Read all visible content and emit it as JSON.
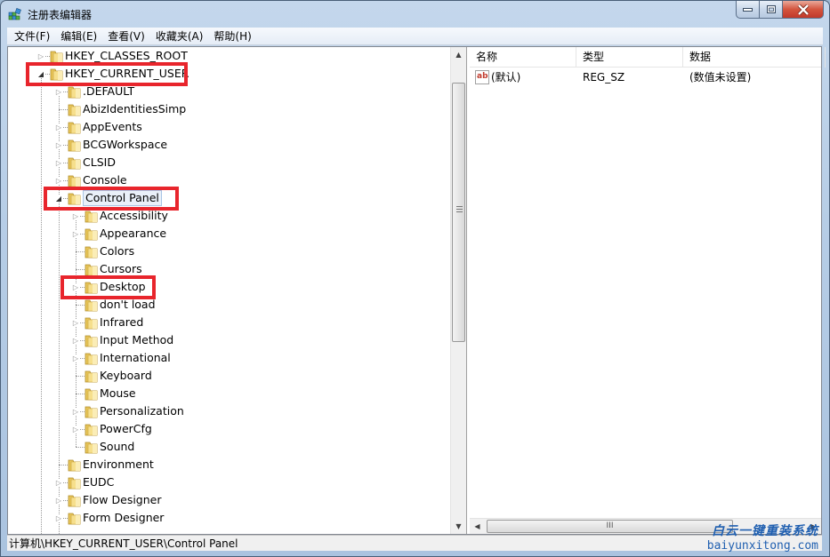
{
  "window": {
    "title": "注册表编辑器",
    "accent_close": "#c0392b"
  },
  "menu": [
    {
      "label": "文件(F)"
    },
    {
      "label": "编辑(E)"
    },
    {
      "label": "查看(V)"
    },
    {
      "label": "收藏夹(A)"
    },
    {
      "label": "帮助(H)"
    }
  ],
  "tree": {
    "items": [
      {
        "label": "HKEY_CLASSES_ROOT",
        "level": 0,
        "expander": "collapsed"
      },
      {
        "label": "HKEY_CURRENT_USER",
        "level": 0,
        "expander": "expanded",
        "highlighted": true
      },
      {
        "label": ".DEFAULT",
        "level": 1,
        "expander": "collapsed"
      },
      {
        "label": "AbizIdentitiesSimp",
        "level": 1,
        "expander": "none"
      },
      {
        "label": "AppEvents",
        "level": 1,
        "expander": "collapsed"
      },
      {
        "label": "BCGWorkspace",
        "level": 1,
        "expander": "collapsed"
      },
      {
        "label": "CLSID",
        "level": 1,
        "expander": "collapsed"
      },
      {
        "label": "Console",
        "level": 1,
        "expander": "collapsed"
      },
      {
        "label": "Control Panel",
        "level": 1,
        "expander": "expanded",
        "selected": true,
        "highlighted": true
      },
      {
        "label": "Accessibility",
        "level": 2,
        "expander": "collapsed"
      },
      {
        "label": "Appearance",
        "level": 2,
        "expander": "collapsed"
      },
      {
        "label": "Colors",
        "level": 2,
        "expander": "none"
      },
      {
        "label": "Cursors",
        "level": 2,
        "expander": "none"
      },
      {
        "label": "Desktop",
        "level": 2,
        "expander": "collapsed",
        "highlighted": true
      },
      {
        "label": "don't load",
        "level": 2,
        "expander": "none"
      },
      {
        "label": "Infrared",
        "level": 2,
        "expander": "collapsed"
      },
      {
        "label": "Input Method",
        "level": 2,
        "expander": "collapsed"
      },
      {
        "label": "International",
        "level": 2,
        "expander": "collapsed"
      },
      {
        "label": "Keyboard",
        "level": 2,
        "expander": "none"
      },
      {
        "label": "Mouse",
        "level": 2,
        "expander": "none"
      },
      {
        "label": "Personalization",
        "level": 2,
        "expander": "collapsed"
      },
      {
        "label": "PowerCfg",
        "level": 2,
        "expander": "collapsed"
      },
      {
        "label": "Sound",
        "level": 2,
        "expander": "none"
      },
      {
        "label": "Environment",
        "level": 1,
        "expander": "none"
      },
      {
        "label": "EUDC",
        "level": 1,
        "expander": "collapsed"
      },
      {
        "label": "Flow Designer",
        "level": 1,
        "expander": "collapsed"
      },
      {
        "label": "Form Designer",
        "level": 1,
        "expander": "collapsed"
      }
    ]
  },
  "list": {
    "columns": [
      {
        "label": "名称"
      },
      {
        "label": "类型"
      },
      {
        "label": "数据"
      }
    ],
    "rows": [
      {
        "icon": "string-value-icon",
        "icon_text": "ab",
        "name": "(默认)",
        "type": "REG_SZ",
        "data": "(数值未设置)"
      }
    ]
  },
  "hscroll": {
    "grip": "III"
  },
  "status": {
    "path": "计算机\\HKEY_CURRENT_USER\\Control Panel"
  },
  "watermark": {
    "cn": "白云一键重装系统",
    "en": "baiyunxitong.com"
  },
  "highlight_color": "#e8252c"
}
